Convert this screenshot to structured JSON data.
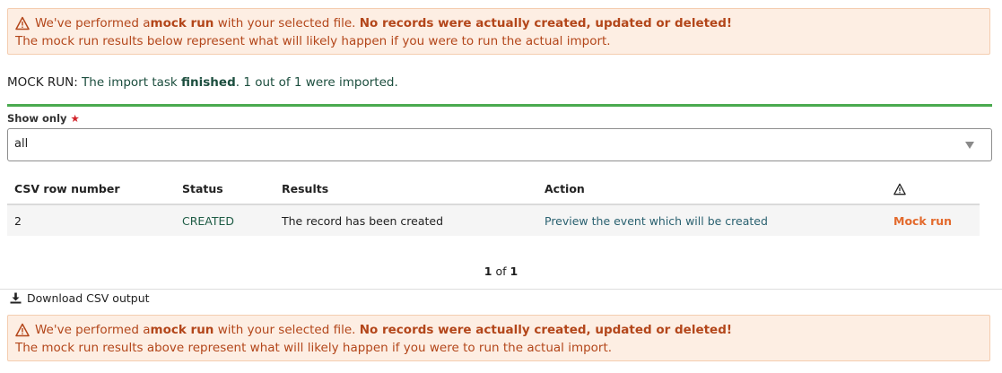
{
  "alert_top": {
    "p1": "We've performed a ",
    "p2": "mock run",
    "p3": " with your selected file. ",
    "p4": "No records were actually created, updated or deleted!",
    "line2": "The mock run results below represent what will likely happen if you were to run the actual import."
  },
  "status": {
    "label": "MOCK RUN:",
    "text1": " The import task ",
    "state": "finished",
    "text2": ". 1 out of 1 were imported."
  },
  "filter": {
    "label": "Show only",
    "required_mark": "★",
    "value": "all"
  },
  "table": {
    "headers": [
      "CSV row number",
      "Status",
      "Results",
      "Action"
    ],
    "warning_header_icon": "warning-icon",
    "rows": [
      {
        "row": "2",
        "status": "CREATED",
        "result": "The record has been created",
        "action": "Preview the event which will be created",
        "flag": "Mock run"
      }
    ]
  },
  "pager": {
    "current": "1",
    "sep": " of ",
    "total": "1"
  },
  "download": {
    "label": "Download CSV output",
    "icon": "download-icon"
  },
  "alert_bottom": {
    "p1": "We've performed a ",
    "p2": "mock run",
    "p3": " with your selected file. ",
    "p4": "No records were actually created, updated or deleted!",
    "line2": "The mock run results above represent what will likely happen if you were to run the actual import."
  },
  "colors": {
    "alert_bg": "#fdeee3",
    "alert_text": "#b3461a",
    "progress": "#4aaa4f",
    "mock": "#e36a2d",
    "link": "#2a6170"
  }
}
